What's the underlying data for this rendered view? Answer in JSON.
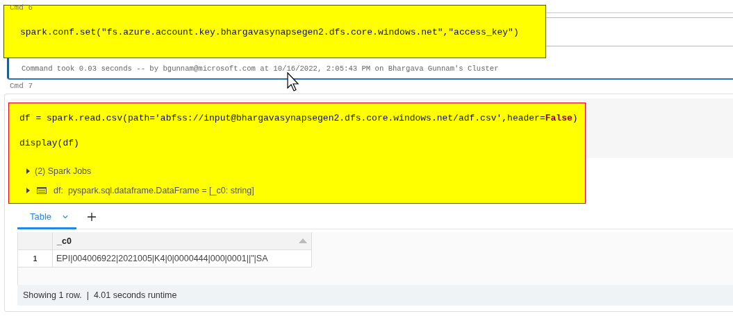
{
  "cells": [
    {
      "label": "Cmd 6",
      "highlighted": true,
      "code": [
        "spark.conf.set(\"fs.azure.account.key.bhargavasynapsegen2.dfs.core.windows.net\",\"access_key\")"
      ],
      "info": "Command took 0.03 seconds -- by bgunnam@microsoft.com at 10/16/2022, 2:05:43 PM on Bhargava Gunnam's Cluster"
    },
    {
      "label": "Cmd 7",
      "highlighted": true,
      "code": [
        "df = spark.read.csv(path='abfss://input@bhargavasynapsegen2.dfs.core.windows.net/adf.csv',header=**False**)",
        "display(df)"
      ],
      "outputs": [
        {
          "kind": "jobs",
          "text": "(2) Spark Jobs"
        },
        {
          "kind": "dataframe",
          "name": "df:",
          "schema": "pyspark.sql.dataframe.DataFrame = [_c0: string]"
        }
      ],
      "result": {
        "tabs": [
          {
            "label": "Table",
            "selected": true
          }
        ],
        "columns": [
          "_c0"
        ],
        "rows": [
          {
            "index": "1",
            "cells": [
              "EPI|004006922|2021005|K4|0|0000444|000|0001||\"|SA"
            ]
          }
        ],
        "footer": "Showing 1 row.  |  4.01 seconds runtime"
      }
    }
  ]
}
